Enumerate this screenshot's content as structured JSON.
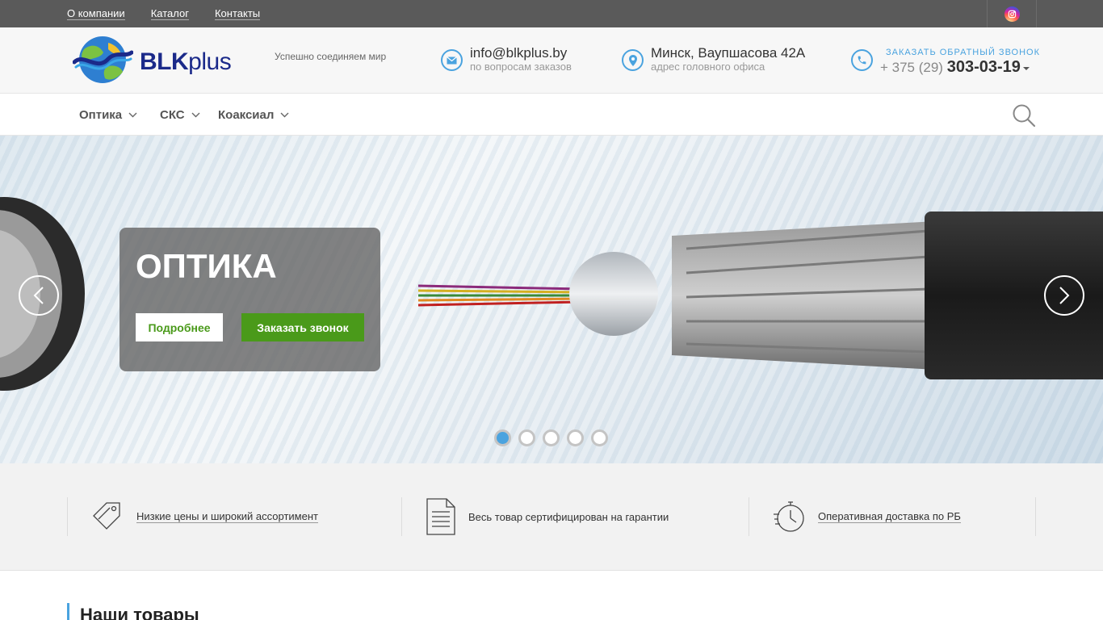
{
  "topbar": {
    "links": [
      "О компании",
      "Каталог",
      "Контакты"
    ],
    "social_icon": "instagram-icon"
  },
  "header": {
    "logo_text_bold": "BLK",
    "logo_text_light": "plus",
    "slogan": "Успешно соединяем мир",
    "email": "info@blkplus.by",
    "email_sub": "по вопросам заказов",
    "address": "Минск, Ваупшасова 42А",
    "address_sub": "адрес головного офиса",
    "callback_label": "ЗАКАЗАТЬ ОБРАТНЫЙ ЗВОНОК",
    "phone_prefix": "+ 375 (29)",
    "phone_number": "303-03-19"
  },
  "nav": {
    "items": [
      "Оптика",
      "СКС",
      "Коаксиал"
    ]
  },
  "slider": {
    "title": "ОПТИКА",
    "more_label": "Подробнее",
    "call_label": "Заказать звонок",
    "dot_count": 5,
    "active_dot": 0
  },
  "features": [
    {
      "text": "Низкие цены и широкий ассортимент",
      "icon": "price-tag-icon"
    },
    {
      "text": "Весь товар сертифицирован на гарантии",
      "icon": "document-icon"
    },
    {
      "text": "Оперативная доставка по РБ",
      "icon": "stopwatch-icon"
    }
  ],
  "section": {
    "title": "Наши товары"
  },
  "colors": {
    "accent_blue": "#4aa3df",
    "accent_green": "#4a9a1a",
    "topbar": "#5a5a5a",
    "logo_blue": "#1b2a8a"
  }
}
